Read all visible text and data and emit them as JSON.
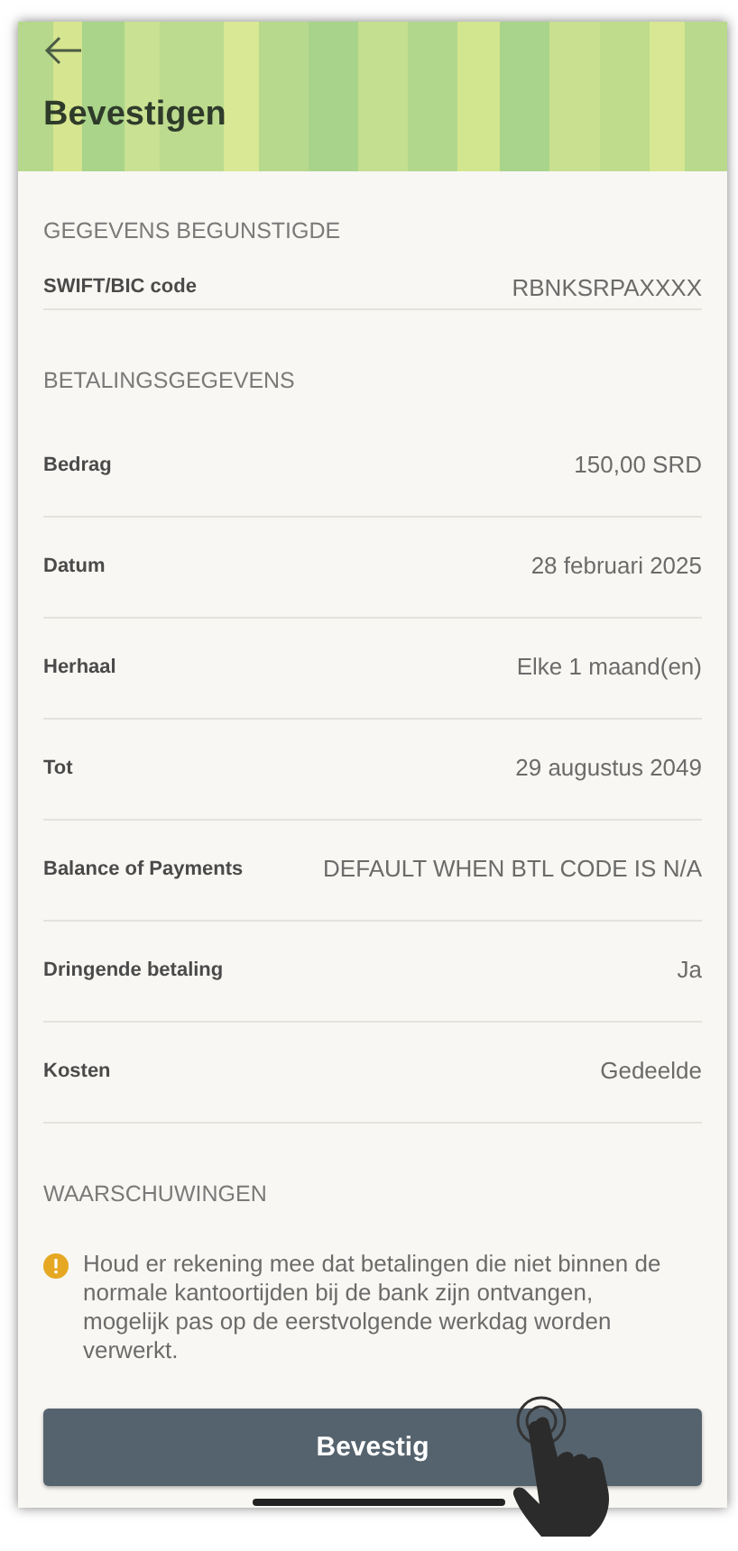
{
  "header": {
    "title": "Bevestigen"
  },
  "sections": [
    {
      "title": "GEGEVENS BEGUNSTIGDE",
      "rows": [
        {
          "label": "SWIFT/BIC code",
          "value": "RBNKSRPAXXXX"
        }
      ]
    },
    {
      "title": "BETALINGSGEGEVENS",
      "rows": [
        {
          "label": "Bedrag",
          "value": "150,00 SRD"
        },
        {
          "label": "Datum",
          "value": "28 februari 2025"
        },
        {
          "label": "Herhaal",
          "value": "Elke 1 maand(en)"
        },
        {
          "label": "Tot",
          "value": "29 augustus 2049"
        },
        {
          "label": "Balance of Payments",
          "value": "DEFAULT WHEN BTL CODE IS N/A"
        },
        {
          "label": "Dringende betaling",
          "value": "Ja"
        },
        {
          "label": "Kosten",
          "value": "Gedeelde"
        }
      ]
    },
    {
      "title": "WAARSCHUWINGEN"
    }
  ],
  "warning": {
    "text": "Houd er rekening mee dat betalingen die niet binnen de normale kantoortijden bij de bank zijn ontvangen, mogelijk pas op de eerstvolgende werkdag worden verwerkt."
  },
  "confirm_button": {
    "label": "Bevestig"
  }
}
